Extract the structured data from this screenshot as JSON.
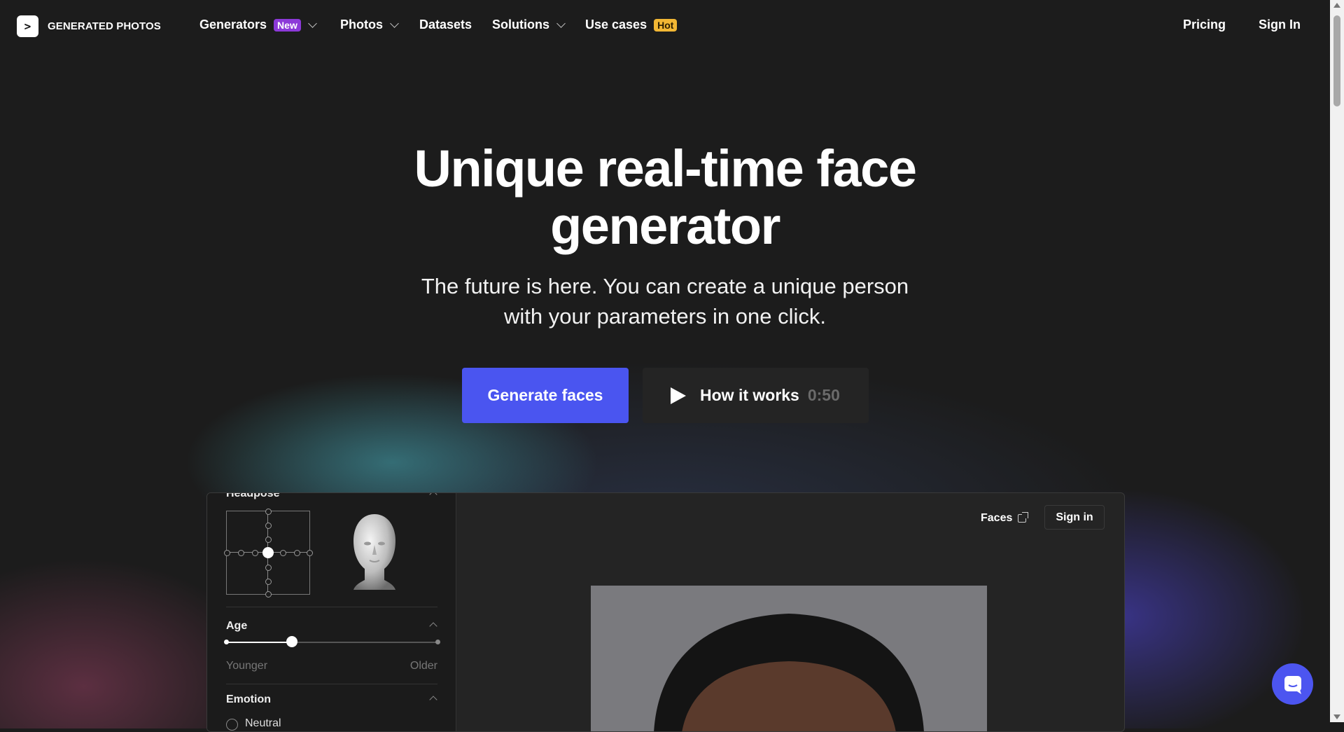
{
  "brand": {
    "name": "GENERATED PHOTOS",
    "mark": ">"
  },
  "nav": {
    "items": [
      {
        "label": "Generators",
        "badge": "New"
      },
      {
        "label": "Photos"
      },
      {
        "label": "Datasets"
      },
      {
        "label": "Solutions"
      },
      {
        "label": "Use cases",
        "badge": "Hot"
      }
    ],
    "pricing": "Pricing",
    "sign_in": "Sign In"
  },
  "hero": {
    "title_line1": "Unique real-time face",
    "title_line2": "generator",
    "subtitle_line1": "The future is here. You can create a unique person",
    "subtitle_line2": "with your parameters in one click.",
    "primary_button": "Generate faces",
    "secondary_button": "How it works",
    "video_duration": "0:50"
  },
  "app": {
    "sidebar": {
      "headpose_label": "Headpose",
      "age_label": "Age",
      "age_value": 0.31,
      "age_min_label": "Younger",
      "age_max_label": "Older",
      "emotion_label": "Emotion",
      "emotion_option": "Neutral"
    },
    "toolbar": {
      "faces_link": "Faces",
      "sign_in": "Sign in"
    }
  },
  "colors": {
    "accent": "#4a55f0",
    "badge_new": "#8c39d8",
    "badge_hot": "#f2b734",
    "background": "#1c1c1c"
  },
  "icons": {
    "logo": "chevron-right-icon",
    "play": "play-icon",
    "external": "external-link-icon",
    "chat": "chat-icon"
  }
}
